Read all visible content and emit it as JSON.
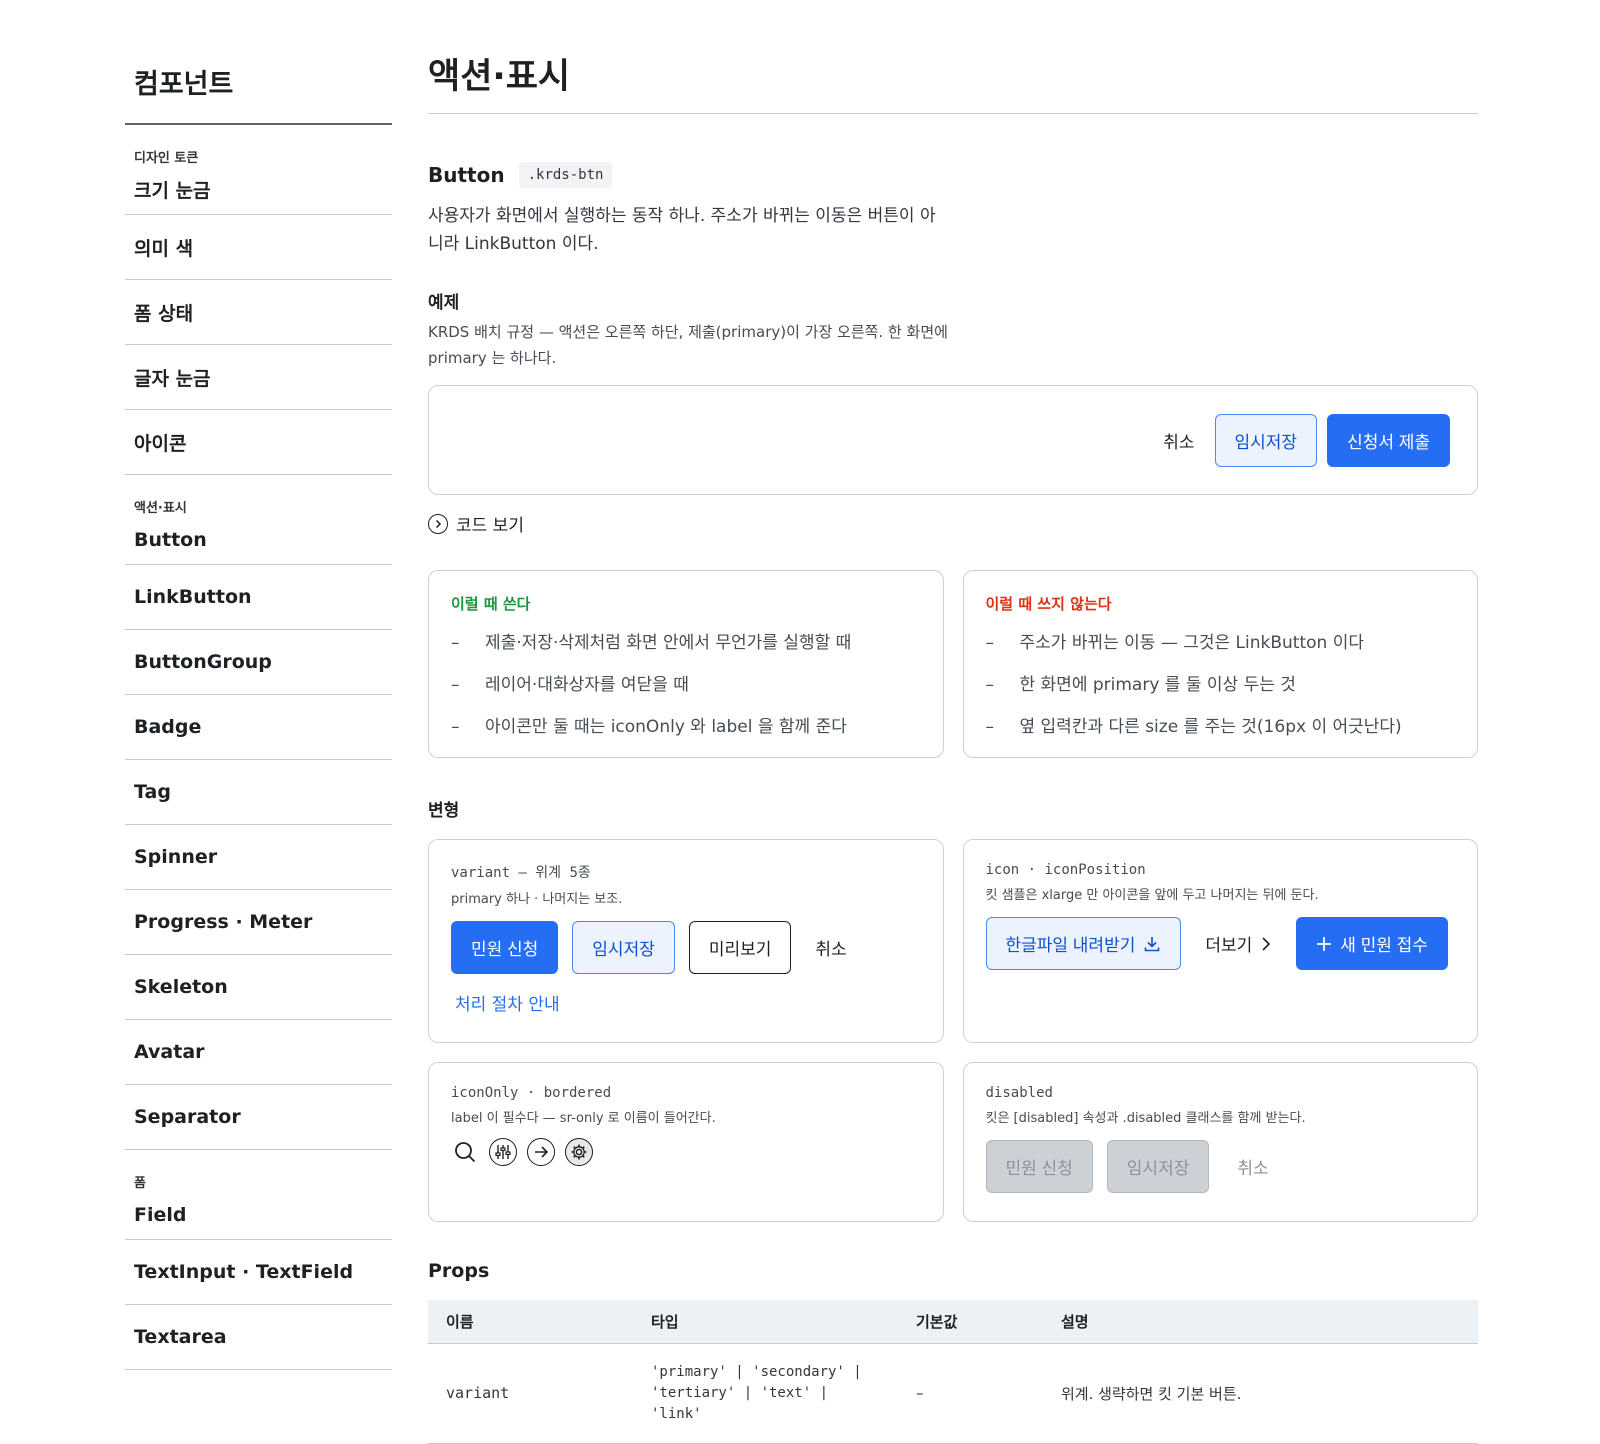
{
  "sidebar": {
    "title": "컴포넌트",
    "groups": [
      {
        "label": "디자인 토큰",
        "items": [
          "크기 눈금",
          "의미 색",
          "폼 상태",
          "글자 눈금",
          "아이콘"
        ]
      },
      {
        "label": "액션·표시",
        "items": [
          "Button",
          "LinkButton",
          "ButtonGroup",
          "Badge",
          "Tag",
          "Spinner",
          "Progress · Meter",
          "Skeleton",
          "Avatar",
          "Separator"
        ]
      },
      {
        "label": "폼",
        "items": [
          "Field",
          "TextInput · TextField",
          "Textarea"
        ]
      }
    ]
  },
  "main": {
    "title": "액션·표시",
    "button_section": {
      "title": "Button",
      "class_chip": ".krds-btn",
      "description": "사용자가 화면에서 실행하는 동작 하나. 주소가 바뀌는 이동은 버튼이 아니라 LinkButton 이다."
    },
    "example": {
      "heading": "예제",
      "description": "KRDS 배치 규정 — 액션은 오른쪽 하단, 제출(primary)이 가장 오른쪽. 한 화면에 primary 는 하나다.",
      "buttons": {
        "cancel": "취소",
        "draft": "임시저장",
        "submit": "신청서 제출"
      },
      "code_toggle": "코드 보기"
    },
    "usage": {
      "do_title": "이럴 때 쓴다",
      "do_items": [
        "제출·저장·삭제처럼 화면 안에서 무언가를 실행할 때",
        "레이어·대화상자를 여닫을 때",
        "아이콘만 둘 때는 iconOnly 와 label 을 함께 준다"
      ],
      "dont_title": "이럴 때 쓰지 않는다",
      "dont_items": [
        "주소가 바뀌는 이동 — 그것은 LinkButton 이다",
        "한 화면에 primary 를 둘 이상 두는 것",
        "옆 입력칸과 다른 size 를 주는 것(16px 이 어긋난다)"
      ]
    },
    "variants": {
      "heading": "변형",
      "variant_card": {
        "label": "variant — 위계 5종",
        "sub": "primary 하나 · 나머지는 보조.",
        "primary": "민원 신청",
        "secondary": "임시저장",
        "tertiary": "미리보기",
        "text": "취소",
        "link": "처리 절차 안내"
      },
      "icon_card": {
        "label": "icon · iconPosition",
        "sub": "킷 샘플은 xlarge 만 아이콘을 앞에 두고 나머지는 뒤에 둔다.",
        "download": "한글파일 내려받기",
        "more": "더보기",
        "new": "새 민원 접수"
      },
      "icononly_card": {
        "label": "iconOnly · bordered",
        "sub": "label 이 필수다 — sr-only 로 이름이 들어간다."
      },
      "disabled_card": {
        "label": "disabled",
        "sub": "킷은 [disabled] 속성과 .disabled 클래스를 함께 받는다.",
        "primary": "민원 신청",
        "secondary": "임시저장",
        "text": "취소"
      }
    },
    "props": {
      "title": "Props",
      "columns": [
        "이름",
        "타입",
        "기본값",
        "설명"
      ],
      "rows": [
        {
          "name": "variant",
          "type": "'primary' | 'secondary' | 'tertiary' | 'text' | 'link'",
          "default": "–",
          "desc": "위계. 생략하면 킷 기본 버튼."
        }
      ]
    }
  }
}
